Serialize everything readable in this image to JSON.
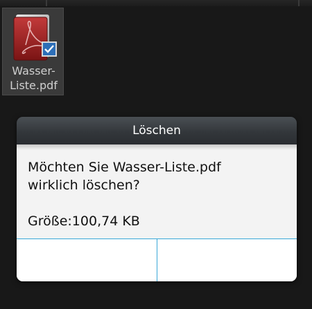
{
  "file": {
    "name_line1": "Wasser-",
    "name_line2": "Liste.pdf",
    "icon": "pdf-file-icon",
    "selected_icon": "checkbox-checked-icon"
  },
  "dialog": {
    "title": "Löschen",
    "message_line1": "Möchten Sie Wasser-Liste.pdf",
    "message_line2": "wirklich löschen?",
    "size_text": "Größe:100,74 KB",
    "button_left_label": "",
    "button_right_label": ""
  },
  "colors": {
    "accent_divider": "#39a7d8",
    "dialog_body": "#f3f3f3",
    "background": "#181818"
  }
}
